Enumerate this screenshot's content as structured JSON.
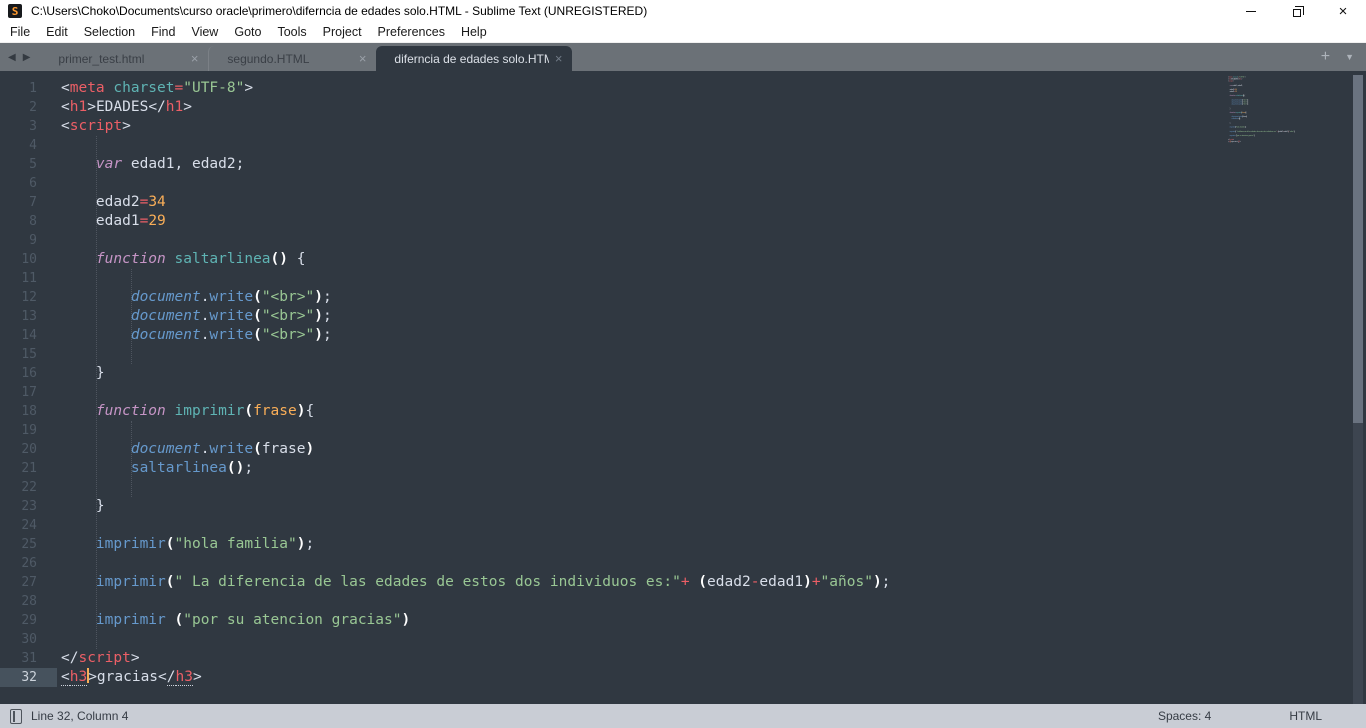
{
  "window": {
    "title": "C:\\Users\\Choko\\Documents\\curso oracle\\primero\\diferncia de edades solo.HTML - Sublime Text (UNREGISTERED)",
    "logo_glyph": "S",
    "close_glyph": "×"
  },
  "menu": {
    "items": [
      "File",
      "Edit",
      "Selection",
      "Find",
      "View",
      "Goto",
      "Tools",
      "Project",
      "Preferences",
      "Help"
    ]
  },
  "tabs": {
    "back_icon": "◀",
    "forward_icon": "▶",
    "new_tab_icon": "+",
    "overflow_icon": "▼",
    "close_icon": "×",
    "items": [
      {
        "label": "primer_test.html",
        "active": false
      },
      {
        "label": "segundo.HTML",
        "active": false
      },
      {
        "label": "diferncia de edades solo.HTML",
        "active": true
      }
    ]
  },
  "editor": {
    "current_line": 32,
    "line_count": 32,
    "syntax_colors": {
      "p": "#d8dee9",
      "red": "#ec5f66",
      "str": "#99c794",
      "num": "#f9ae58",
      "kw": "#c695c6",
      "sup": "#6699cc",
      "fdef": "#5fb4b4",
      "call": "#6699cc",
      "attr": "#5fb4b4",
      "param": "#f9ae58",
      "paren": "#ffffff"
    },
    "lines": [
      [
        [
          "<",
          "p"
        ],
        [
          "meta",
          "red"
        ],
        [
          " ",
          "p"
        ],
        [
          "charset",
          "attr"
        ],
        [
          "=",
          "red"
        ],
        [
          "\"UTF-8\"",
          "str"
        ],
        [
          ">",
          "p"
        ]
      ],
      [
        [
          "<",
          "p"
        ],
        [
          "h1",
          "red"
        ],
        [
          ">",
          "p"
        ],
        [
          "EDADES",
          "p"
        ],
        [
          "</",
          "p"
        ],
        [
          "h1",
          "red"
        ],
        [
          ">",
          "p"
        ]
      ],
      [
        [
          "<",
          "p"
        ],
        [
          "script",
          "red"
        ],
        [
          ">",
          "p"
        ]
      ],
      [],
      [
        [
          "    ",
          "p"
        ],
        [
          "var",
          "kw"
        ],
        [
          " edad1, edad2;",
          "p"
        ]
      ],
      [],
      [
        [
          "    edad2",
          "p"
        ],
        [
          "=",
          "red"
        ],
        [
          "34",
          "num"
        ]
      ],
      [
        [
          "    edad1",
          "p"
        ],
        [
          "=",
          "red"
        ],
        [
          "29",
          "num"
        ]
      ],
      [],
      [
        [
          "    ",
          "p"
        ],
        [
          "function",
          "kw"
        ],
        [
          " ",
          "p"
        ],
        [
          "saltarlinea",
          "fdef"
        ],
        [
          "()",
          "paren"
        ],
        [
          " {",
          "p"
        ]
      ],
      [],
      [
        [
          "        ",
          "p"
        ],
        [
          "document",
          "sup"
        ],
        [
          ".",
          "p"
        ],
        [
          "write",
          "call"
        ],
        [
          "(",
          "paren"
        ],
        [
          "\"<br>\"",
          "str"
        ],
        [
          ")",
          "paren"
        ],
        [
          ";",
          "p"
        ]
      ],
      [
        [
          "        ",
          "p"
        ],
        [
          "document",
          "sup"
        ],
        [
          ".",
          "p"
        ],
        [
          "write",
          "call"
        ],
        [
          "(",
          "paren"
        ],
        [
          "\"<br>\"",
          "str"
        ],
        [
          ")",
          "paren"
        ],
        [
          ";",
          "p"
        ]
      ],
      [
        [
          "        ",
          "p"
        ],
        [
          "document",
          "sup"
        ],
        [
          ".",
          "p"
        ],
        [
          "write",
          "call"
        ],
        [
          "(",
          "paren"
        ],
        [
          "\"<br>\"",
          "str"
        ],
        [
          ")",
          "paren"
        ],
        [
          ";",
          "p"
        ]
      ],
      [],
      [
        [
          "    }",
          "p"
        ]
      ],
      [],
      [
        [
          "    ",
          "p"
        ],
        [
          "function",
          "kw"
        ],
        [
          " ",
          "p"
        ],
        [
          "imprimir",
          "fdef"
        ],
        [
          "(",
          "paren"
        ],
        [
          "frase",
          "param"
        ],
        [
          ")",
          "paren"
        ],
        [
          "{",
          "p"
        ]
      ],
      [],
      [
        [
          "        ",
          "p"
        ],
        [
          "document",
          "sup"
        ],
        [
          ".",
          "p"
        ],
        [
          "write",
          "call"
        ],
        [
          "(",
          "paren"
        ],
        [
          "frase",
          "p"
        ],
        [
          ")",
          "paren"
        ]
      ],
      [
        [
          "        ",
          "p"
        ],
        [
          "saltarlinea",
          "call"
        ],
        [
          "()",
          "paren"
        ],
        [
          ";",
          "p"
        ]
      ],
      [],
      [
        [
          "    }",
          "p"
        ]
      ],
      [],
      [
        [
          "    ",
          "p"
        ],
        [
          "imprimir",
          "call"
        ],
        [
          "(",
          "paren"
        ],
        [
          "\"hola familia\"",
          "str"
        ],
        [
          ")",
          "paren"
        ],
        [
          ";",
          "p"
        ]
      ],
      [],
      [
        [
          "    ",
          "p"
        ],
        [
          "imprimir",
          "call"
        ],
        [
          "(",
          "paren"
        ],
        [
          "\" La diferencia de las edades de estos dos individuos es:\"",
          "str"
        ],
        [
          "+",
          "red"
        ],
        [
          " ",
          "p"
        ],
        [
          "(",
          "paren"
        ],
        [
          "edad2",
          "p"
        ],
        [
          "-",
          "red"
        ],
        [
          "edad1",
          "p"
        ],
        [
          ")",
          "paren"
        ],
        [
          "+",
          "red"
        ],
        [
          "\"años\"",
          "str"
        ],
        [
          ")",
          "paren"
        ],
        [
          ";",
          "p"
        ]
      ],
      [],
      [
        [
          "    ",
          "p"
        ],
        [
          "imprimir",
          "call"
        ],
        [
          " ",
          "p"
        ],
        [
          "(",
          "paren"
        ],
        [
          "\"por su atencion gracias\"",
          "str"
        ],
        [
          ")",
          "paren"
        ]
      ],
      [],
      [
        [
          "</",
          "p"
        ],
        [
          "script",
          "red"
        ],
        [
          ">",
          "p"
        ]
      ],
      [
        [
          "<",
          "pu"
        ],
        [
          "h3",
          "redu"
        ],
        [
          "",
          "caret"
        ],
        [
          ">gracias",
          "p"
        ],
        [
          "<",
          "p"
        ],
        [
          "/",
          "pu"
        ],
        [
          "h3",
          "redu"
        ],
        [
          ">",
          "p"
        ]
      ]
    ]
  },
  "status": {
    "position": "Line 32, Column 4",
    "indent": "Spaces: 4",
    "syntax": "HTML"
  }
}
